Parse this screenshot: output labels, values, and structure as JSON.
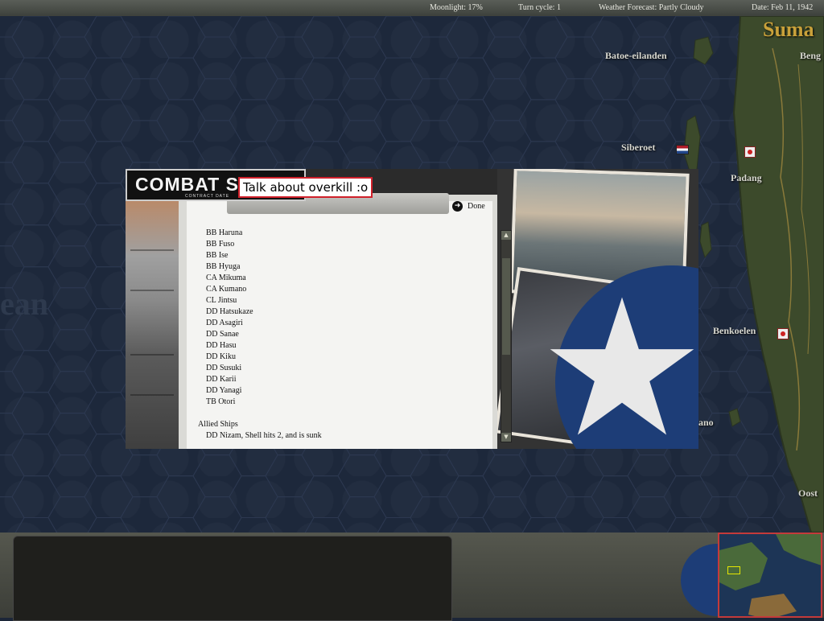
{
  "status_bar": {
    "moonlight": "Moonlight: 17%",
    "turn_cycle": "Turn cycle: 1",
    "weather": "Weather Forecast: Partly Cloudy",
    "date": "Date: Feb 11, 1942"
  },
  "map": {
    "ocean_label": "ean",
    "region_label": "Suma",
    "places": {
      "batoe": "Batoe-eilanden",
      "beng": "Beng",
      "siberoet": "Siberoet",
      "padang": "Padang",
      "benkoelen": "Benkoelen",
      "ano": "ano",
      "oost": "Oost"
    },
    "colors": {
      "sea": "#1d283b",
      "land": "#3d4a2a",
      "dutch_flag": [
        "#ae1c28",
        "#ffffff",
        "#21468b"
      ],
      "japanese_marker": "#cc2222"
    }
  },
  "dialog": {
    "title": "COMBAT SUI",
    "subtitle": "CONTRACT DATE",
    "caption": "Talk about overkill :o",
    "done_label": "Done",
    "japanese_ships": [
      "BB Haruna",
      "BB Fuso",
      "BB Ise",
      "BB Hyuga",
      "CA Mikuma",
      "CA Kumano",
      "CL Jintsu",
      "DD Hatsukaze",
      "DD Asagiri",
      "DD Sanae",
      "DD Hasu",
      "DD Kiku",
      "DD Susuki",
      "DD Karii",
      "DD Yanagi",
      "TB Otori"
    ],
    "allied_heading": "Allied Ships",
    "allied_ship": "DD Nizam, Shell hits 2, and is sunk"
  },
  "icons": {
    "done": "arrow-right-circle-icon",
    "scroll_up": "up-arrow-icon",
    "scroll_down": "down-arrow-icon"
  }
}
